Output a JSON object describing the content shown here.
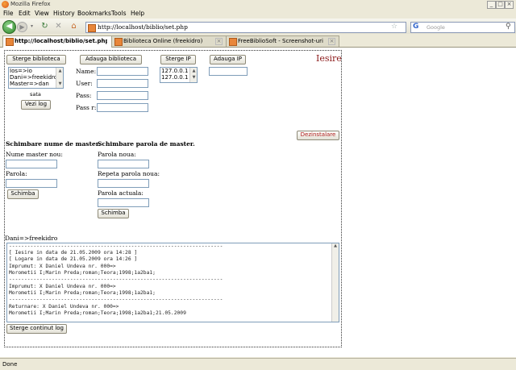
{
  "window": {
    "title": "Mozilla Firefox"
  },
  "menu": [
    "File",
    "Edit",
    "View",
    "History",
    "Bookmarks",
    "Tools",
    "Help"
  ],
  "nav": {
    "url": "http://localhost/biblio/set.php",
    "search_placeholder": "Google"
  },
  "tabs": [
    {
      "label": "http://localhost/biblio/set.php"
    },
    {
      "label": "Biblioteca Online (freekidro)"
    },
    {
      "label": "FreeBiblioSoft - Screenshot-uri"
    }
  ],
  "page": {
    "btn_sterge_biblioteca": "Sterge biblioteca",
    "btn_adauga_biblioteca": "Adauga biblioteca",
    "btn_sterge_ip": "Sterge IP",
    "btn_adauga_ip": "Adauga IP",
    "iesire": "Iesire",
    "users_list": [
      "Ios=>io",
      "Dani=>freekidro",
      "Master=>dan"
    ],
    "sata": "sata",
    "btn_vezi_log": "Vezi log",
    "label_name": "Name:",
    "label_user": "User:",
    "label_pass": "Pass:",
    "label_pass_r": "Pass r:",
    "ip_list": [
      "127.0.0.1",
      "127.0.0.1"
    ],
    "btn_dezinstalare": "Dezinstalare",
    "heading_master_name": "Schimbare nume de master.",
    "label_new_master": "Nume master nou:",
    "label_parola": "Parola:",
    "btn_schimba1": "Schimba",
    "heading_master_pass": "Schimbare parola de master.",
    "label_parola_noua": "Parola noua:",
    "label_repeta": "Repeta parola noua:",
    "label_actuala": "Parola actuala:",
    "btn_schimba2": "Schimba",
    "current_user": "Dani=>freekidro",
    "btn_sterge_log": "Sterge continut log"
  },
  "log": {
    "sep": "----------------------------------------------------------------------",
    "l1": "[ Iesire in data de 21.05.2009 ora 14:28 ]",
    "l2": "[ Logare in data de 21.05.2009 ora 14:26 ]",
    "l3": "Imprumut: X Daniel Undeva nr. 000=>",
    "l4": "Morometii I;Marin Preda;roman;Teora;1998;1a2ba1;",
    "l5": "Imprumut: X Daniel Undeva nr. 000=>",
    "l6": "Morometii I;Marin Preda;roman;Teora;1998;1a2ba1;",
    "l7": "Returnare: X Daniel Undeva nr. 000=>",
    "l8": "Morometii I;Marin Preda;roman;Teora;1998;1a2ba1;21.05.2009"
  },
  "status": {
    "text": "Done"
  }
}
